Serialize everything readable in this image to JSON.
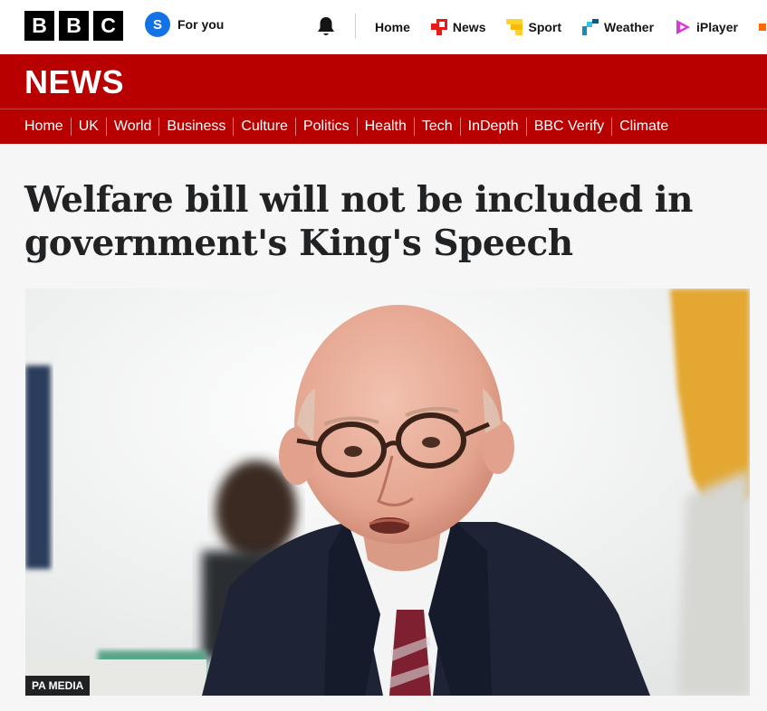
{
  "header": {
    "logo_letters": [
      "B",
      "B",
      "C"
    ],
    "signin_initial": "S",
    "signin_label": "For you",
    "nav": [
      {
        "label": "Home",
        "icon": "none"
      },
      {
        "label": "News",
        "icon": "news-icon",
        "color": "#e81a1a"
      },
      {
        "label": "Sport",
        "icon": "sport-icon",
        "color": "#ffd230"
      },
      {
        "label": "Weather",
        "icon": "weather-icon",
        "color": "#1b8ab5"
      },
      {
        "label": "iPlayer",
        "icon": "iplayer-icon",
        "color": "#d63ad4"
      }
    ]
  },
  "news": {
    "wordmark": "NEWS",
    "brand_color": "#b80000",
    "nav": [
      "Home",
      "UK",
      "World",
      "Business",
      "Culture",
      "Politics",
      "Health",
      "Tech",
      "InDepth",
      "BBC Verify",
      "Climate"
    ]
  },
  "article": {
    "headline": "Welfare bill will not be included in government's King's Speech",
    "image_credit": "PA MEDIA"
  }
}
